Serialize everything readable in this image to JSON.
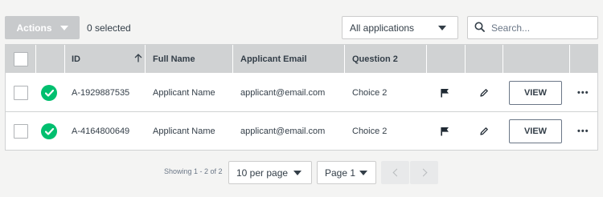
{
  "toolbar": {
    "actions_label": "Actions",
    "selected_count_text": "0 selected",
    "application_filter": "All applications",
    "search_placeholder": "Search..."
  },
  "table": {
    "columns": {
      "id": "ID",
      "full_name": "Full Name",
      "email": "Applicant Email",
      "question": "Question 2"
    },
    "sort": {
      "column": "ID",
      "direction": "ascending"
    },
    "rows": [
      {
        "id": "A-1929887535",
        "full_name": "Applicant Name",
        "email": "applicant@email.com",
        "question": "Choice 2",
        "view_label": "VIEW",
        "more_label": "•••"
      },
      {
        "id": "A-4164800649",
        "full_name": "Applicant Name",
        "email": "applicant@email.com",
        "question": "Choice 2",
        "view_label": "VIEW",
        "more_label": "•••"
      }
    ]
  },
  "pagination": {
    "showing_text": "Showing 1 - 2 of 2",
    "per_page": "10 per page",
    "page": "Page 1"
  },
  "colors": {
    "success": "#00bf6f",
    "header_bg": "#d0d2d3",
    "page_bg": "#f4f4f3",
    "text": "#333e48"
  },
  "icons": {
    "status": "check-circle-icon",
    "flag": "flag-icon",
    "edit": "pencil-icon",
    "search": "search-icon",
    "sort": "arrow-up-icon"
  }
}
